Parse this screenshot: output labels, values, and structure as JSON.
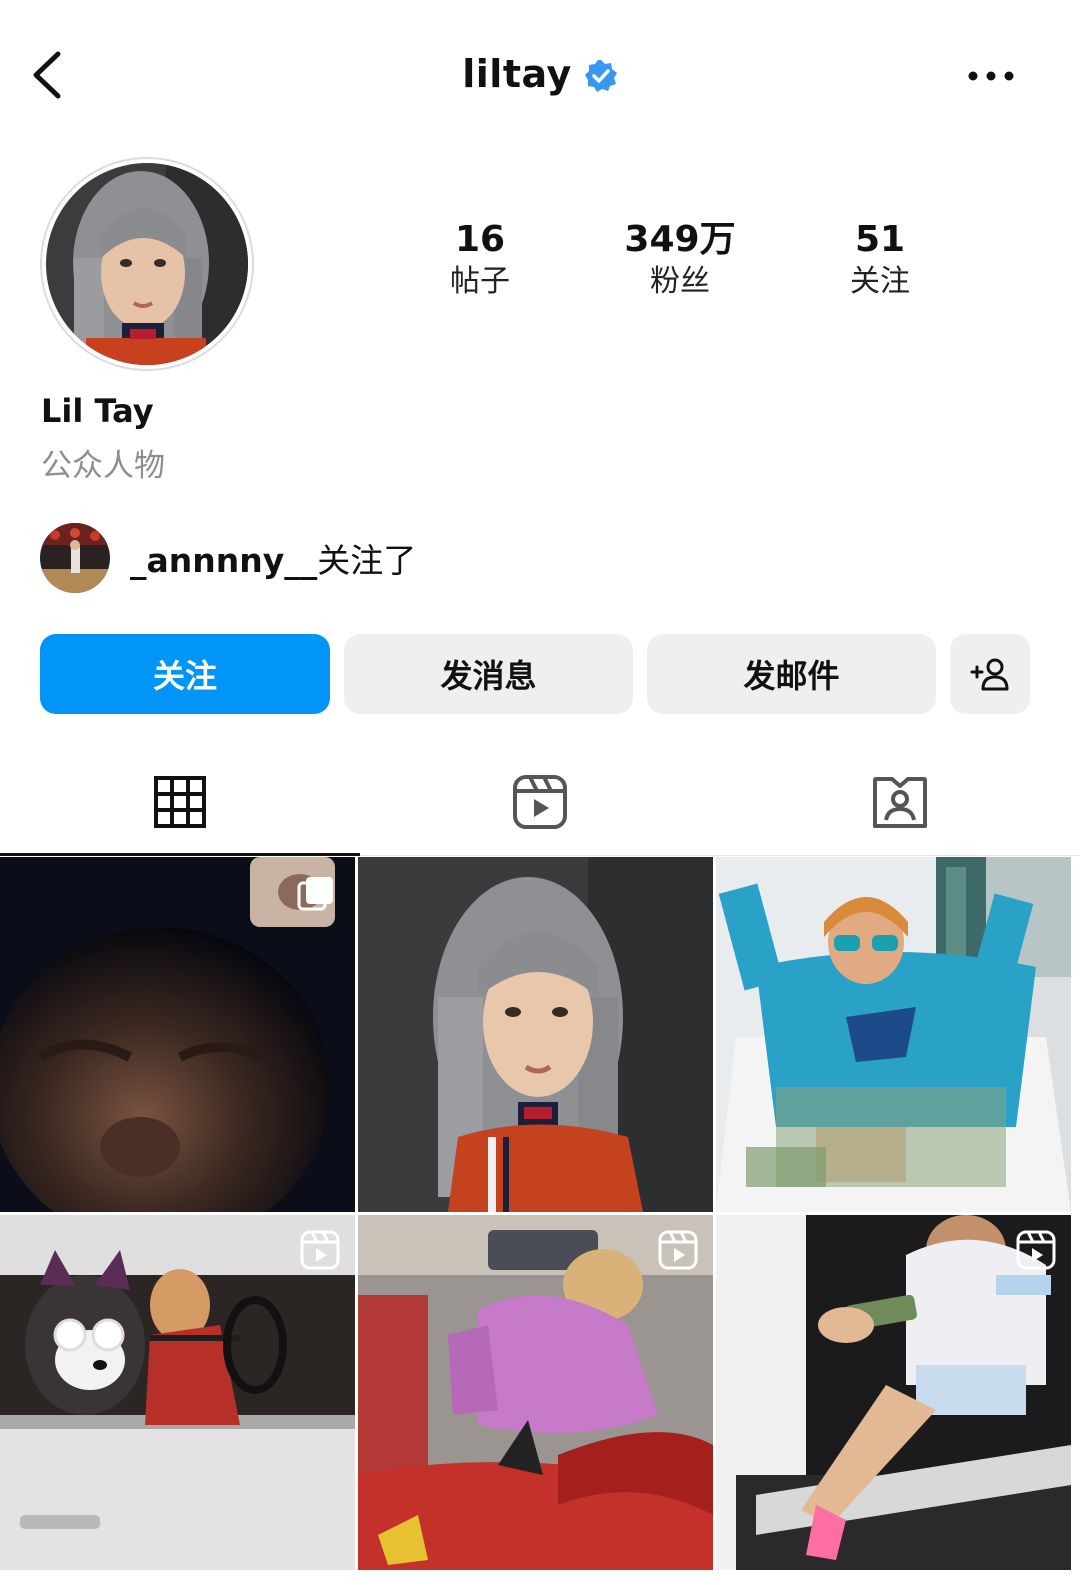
{
  "header": {
    "username": "liltay",
    "verified": true,
    "back_icon": "chevron-left-icon",
    "more_icon": "more-horizontal-icon"
  },
  "profile": {
    "stats": [
      {
        "value": "16",
        "label": "帖子"
      },
      {
        "value": "349万",
        "label": "粉丝"
      },
      {
        "value": "51",
        "label": "关注"
      }
    ],
    "display_name": "Lil Tay",
    "category": "公众人物",
    "followed_by": {
      "username": "_annnny__",
      "suffix": "关注了"
    }
  },
  "actions": {
    "follow_label": "关注",
    "message_label": "发消息",
    "email_label": "发邮件",
    "add_icon": "add-person-icon"
  },
  "tabs": [
    {
      "name": "posts-grid",
      "icon": "grid-icon",
      "active": true
    },
    {
      "name": "reels",
      "icon": "reels-icon",
      "active": false
    },
    {
      "name": "tagged",
      "icon": "tagged-person-icon",
      "active": false
    }
  ],
  "grid": [
    {
      "type": "photo",
      "badge": "none"
    },
    {
      "type": "photo",
      "badge": "none"
    },
    {
      "type": "photo",
      "badge": "none"
    },
    {
      "type": "reel",
      "badge": "reel-icon"
    },
    {
      "type": "reel",
      "badge": "reel-icon"
    },
    {
      "type": "reel",
      "badge": "reel-icon"
    }
  ],
  "colors": {
    "accent": "#0095f6",
    "secondary_button": "#efefef",
    "secondary_text": "#8e8e8e",
    "verified_badge": "#3897f0"
  }
}
